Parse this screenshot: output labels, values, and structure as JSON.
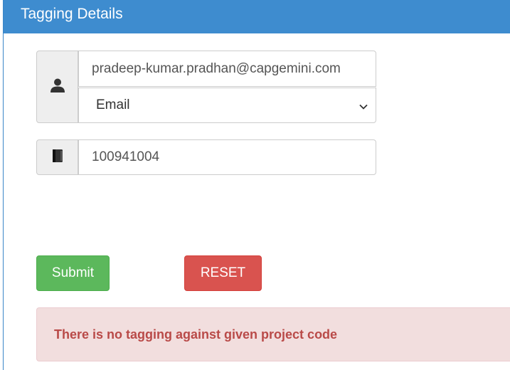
{
  "panel": {
    "title": "Tagging Details"
  },
  "form": {
    "email_value": "pradeep-kumar.pradhan@capgemini.com",
    "id_type_selected": "Email",
    "project_code_value": "100941004",
    "user_icon": "user-icon",
    "book_icon": "book-icon"
  },
  "buttons": {
    "submit_label": "Submit",
    "reset_label": "RESET"
  },
  "alert": {
    "message": "There is no tagging against given project code"
  },
  "colors": {
    "heading": "#3e8ccf",
    "submit": "#5cb85c",
    "reset": "#d9534f",
    "alert_bg": "#f2dede",
    "alert_text": "#b94a48"
  }
}
